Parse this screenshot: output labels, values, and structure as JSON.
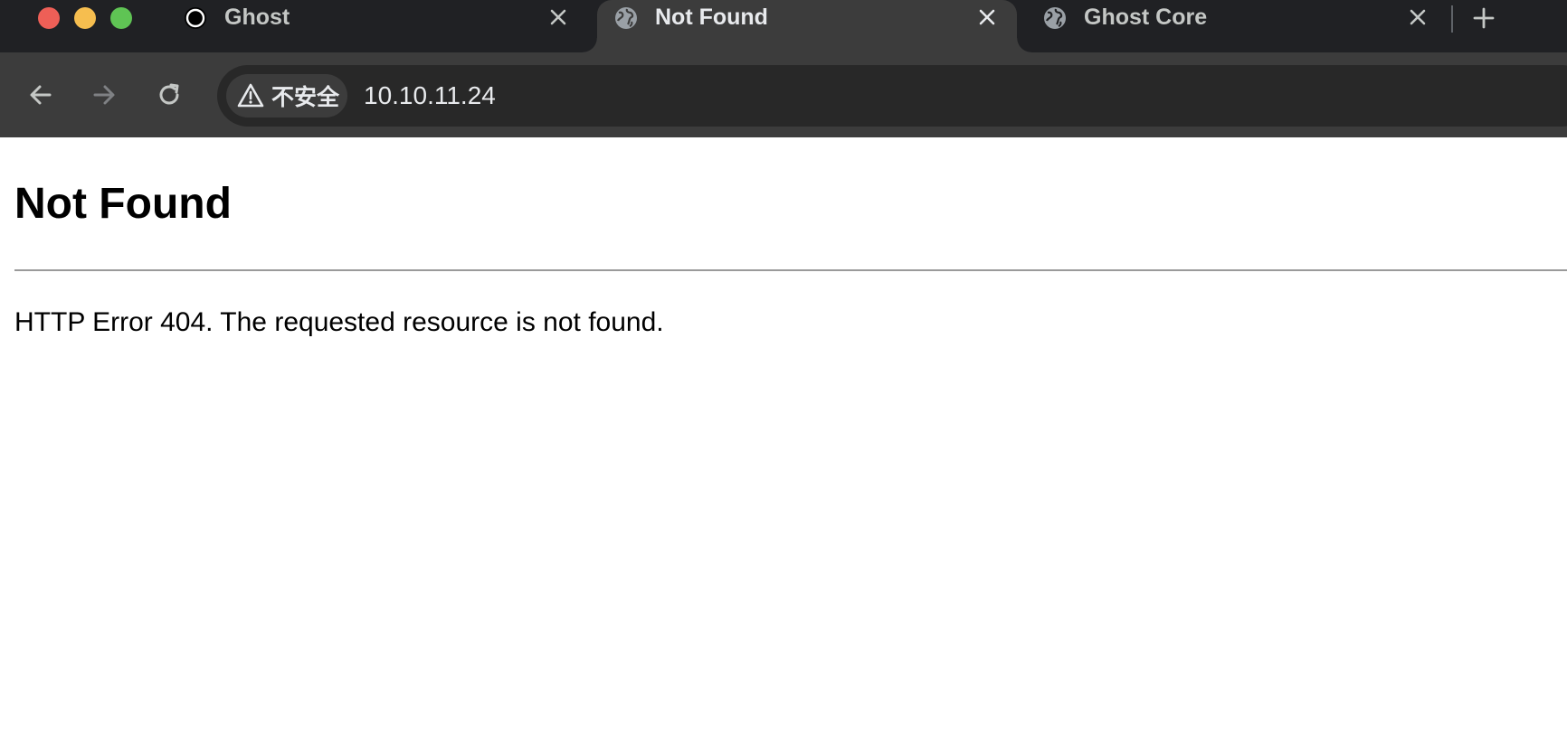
{
  "tabs": [
    {
      "title": "Ghost",
      "icon": "ghost-circle-icon",
      "active": false
    },
    {
      "title": "Not Found",
      "icon": "globe-icon",
      "active": true
    },
    {
      "title": "Ghost Core",
      "icon": "globe-icon",
      "active": false
    }
  ],
  "toolbar": {
    "security_label": "不安全",
    "url": "10.10.11.24"
  },
  "page": {
    "heading": "Not Found",
    "message": "HTTP Error 404. The requested resource is not found."
  },
  "colors": {
    "tabstrip": "#202124",
    "active_tab": "#3c3c3c",
    "omnibox": "#282828",
    "traffic_close": "#ee5f57",
    "traffic_min": "#f6be4f",
    "traffic_max": "#5fc454"
  }
}
